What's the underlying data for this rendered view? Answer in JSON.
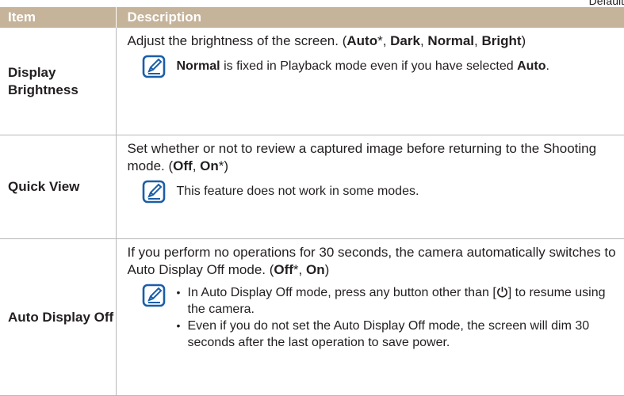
{
  "corner_text": "Default",
  "table": {
    "headers": {
      "item": "Item",
      "description": "Description"
    },
    "rows": [
      {
        "item": "Display Brightness",
        "desc": {
          "t1": "Adjust the brightness of the screen. (",
          "b1": "Auto",
          "t2": "*, ",
          "b2": "Dark",
          "t3": ", ",
          "b3": "Normal",
          "t4": ", ",
          "b4": "Bright",
          "t5": ")"
        },
        "note": {
          "b1": "Normal",
          "t1": " is fixed in Playback mode even if you have selected ",
          "b2": "Auto",
          "t2": "."
        }
      },
      {
        "item": "Quick View",
        "desc": {
          "t1": "Set whether or not to review a captured image before returning to the Shooting mode. (",
          "b1": "Off",
          "t2": ", ",
          "b2": "On",
          "t3": "*)"
        },
        "note": {
          "text": "This feature does not work in some modes."
        }
      },
      {
        "item": "Auto Display Off",
        "desc": {
          "t1": "If you perform no operations for 30 seconds, the camera automatically switches to Auto Display Off mode. (",
          "b1": "Off",
          "t2": "*, ",
          "b2": "On",
          "t3": ")"
        },
        "note": {
          "bullet1_a": "In Auto Display Off mode, press any button other than [",
          "bullet1_b": "] to resume using the camera.",
          "bullet2": "Even if you do not set the Auto Display Off mode, the screen will dim 30 seconds after the last operation to save power."
        }
      }
    ]
  },
  "icons": {
    "note": "note-pencil-icon",
    "power": "power-icon"
  },
  "colors": {
    "header_bg": "#c5b39a",
    "icon_blue": "#1a5ea8",
    "text": "#231f20"
  }
}
